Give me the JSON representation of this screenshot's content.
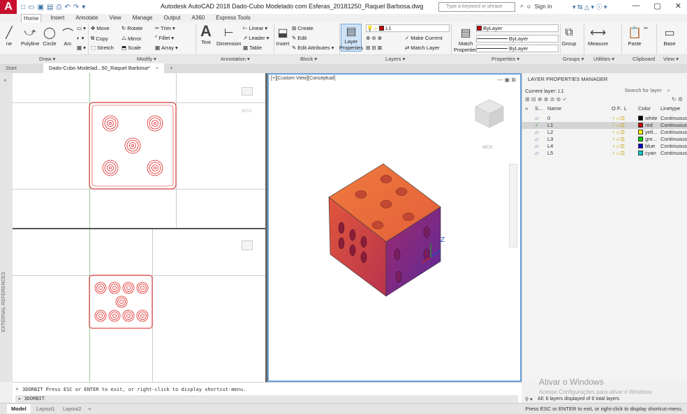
{
  "app": {
    "logo": "A",
    "title": "Autodesk AutoCAD 2018   Dado-Cubo Modelado com Esferas_20181250_Raquel Barbosa.dwg",
    "search_placeholder": "Type a keyword or phrase",
    "signin": "Sign In"
  },
  "menu_tabs": [
    "Home",
    "Insert",
    "Annotate",
    "View",
    "Manage",
    "Output",
    "A360",
    "Express Tools"
  ],
  "ribbon": {
    "draw": {
      "polyline": "Polyline",
      "circle": "Circle",
      "arc": "Arc",
      "line": "ne"
    },
    "modify": {
      "move": "Move",
      "rotate": "Rotate",
      "trim": "Trim",
      "copy": "Copy",
      "mirror": "Mirror",
      "fillet": "Fillet",
      "stretch": "Stretch",
      "scale": "Scale",
      "array": "Array"
    },
    "annotation": {
      "text": "Text",
      "dimension": "Dimension",
      "linear": "Linear",
      "leader": "Leader",
      "table": "Table"
    },
    "block": {
      "insert": "Insert",
      "create": "Create",
      "edit": "Edit",
      "edit_attributes": "Edit Attributes"
    },
    "layers": {
      "layer_properties_1": "Layer",
      "layer_properties_2": "Properties",
      "current": "L1",
      "make_current": "Make Current",
      "match_layer": "Match Layer"
    },
    "properties": {
      "match_1": "Match",
      "match_2": "Properties",
      "bylayer1": "ByLayer",
      "bylayer2": "ByLayer",
      "bylayer3": "ByLayer"
    },
    "groups": {
      "group": "Group"
    },
    "utilities": {
      "measure": "Measure"
    },
    "clipboard": {
      "paste": "Paste"
    },
    "view": {
      "base": "Base"
    },
    "panel_labels": [
      "Draw ▾",
      "Modify ▾",
      "Annotation ▾",
      "Block ▾",
      "Layers ▾",
      "Properties ▾",
      "Groups ▾",
      "Utilities ▾",
      "Clipboard",
      "View ▾"
    ]
  },
  "doc_tabs": [
    "Start",
    "Dado-Cubo Modelad...50_Raquel Barbosa*"
  ],
  "left_strip": "EXTERNAL REFERENCES",
  "viewport_main": {
    "label": "[+][Custom View][Conceptual]",
    "wcs": "WCS"
  },
  "viewport_top": {
    "wcs": "WCS"
  },
  "layer_panel": {
    "title": "LAYER PROPERTIES MANAGER",
    "current_layer": "Current layer: L1",
    "search": "Search for layer",
    "headers": {
      "status": "S...",
      "name": "Name",
      "flags": "O  F..  L",
      "color": "Color",
      "linetype": "Linetype"
    },
    "layers": [
      {
        "name": "0",
        "color_name": "white",
        "color": "#000000",
        "linetype": "Continuous"
      },
      {
        "name": "L1",
        "color_name": "red",
        "color": "#cc0000",
        "linetype": "Continuous"
      },
      {
        "name": "L2",
        "color_name": "yell...",
        "color": "#ffff00",
        "linetype": "Continuous"
      },
      {
        "name": "L3",
        "color_name": "gre...",
        "color": "#00cc00",
        "linetype": "Continuous"
      },
      {
        "name": "L4",
        "color_name": "blue",
        "color": "#0000cc",
        "linetype": "Continuous"
      },
      {
        "name": "L5",
        "color_name": "cyan",
        "color": "#00cccc",
        "linetype": "Continuous"
      }
    ],
    "footer": "All: 6 layers displayed of 6 total layers",
    "watermark_1": "Ativar o Windows",
    "watermark_2": "Acesse Configurações para ativar o Windows."
  },
  "command": {
    "history": "3DORBIT Press ESC or ENTER to exit, or right-click to display shortcut-menu.",
    "input": "3DORBIT"
  },
  "status": {
    "tabs": [
      "Model",
      "Layout1",
      "Layout2"
    ],
    "message": "Press ESC or ENTER to exit, or right-click to display shortcut-menu."
  }
}
